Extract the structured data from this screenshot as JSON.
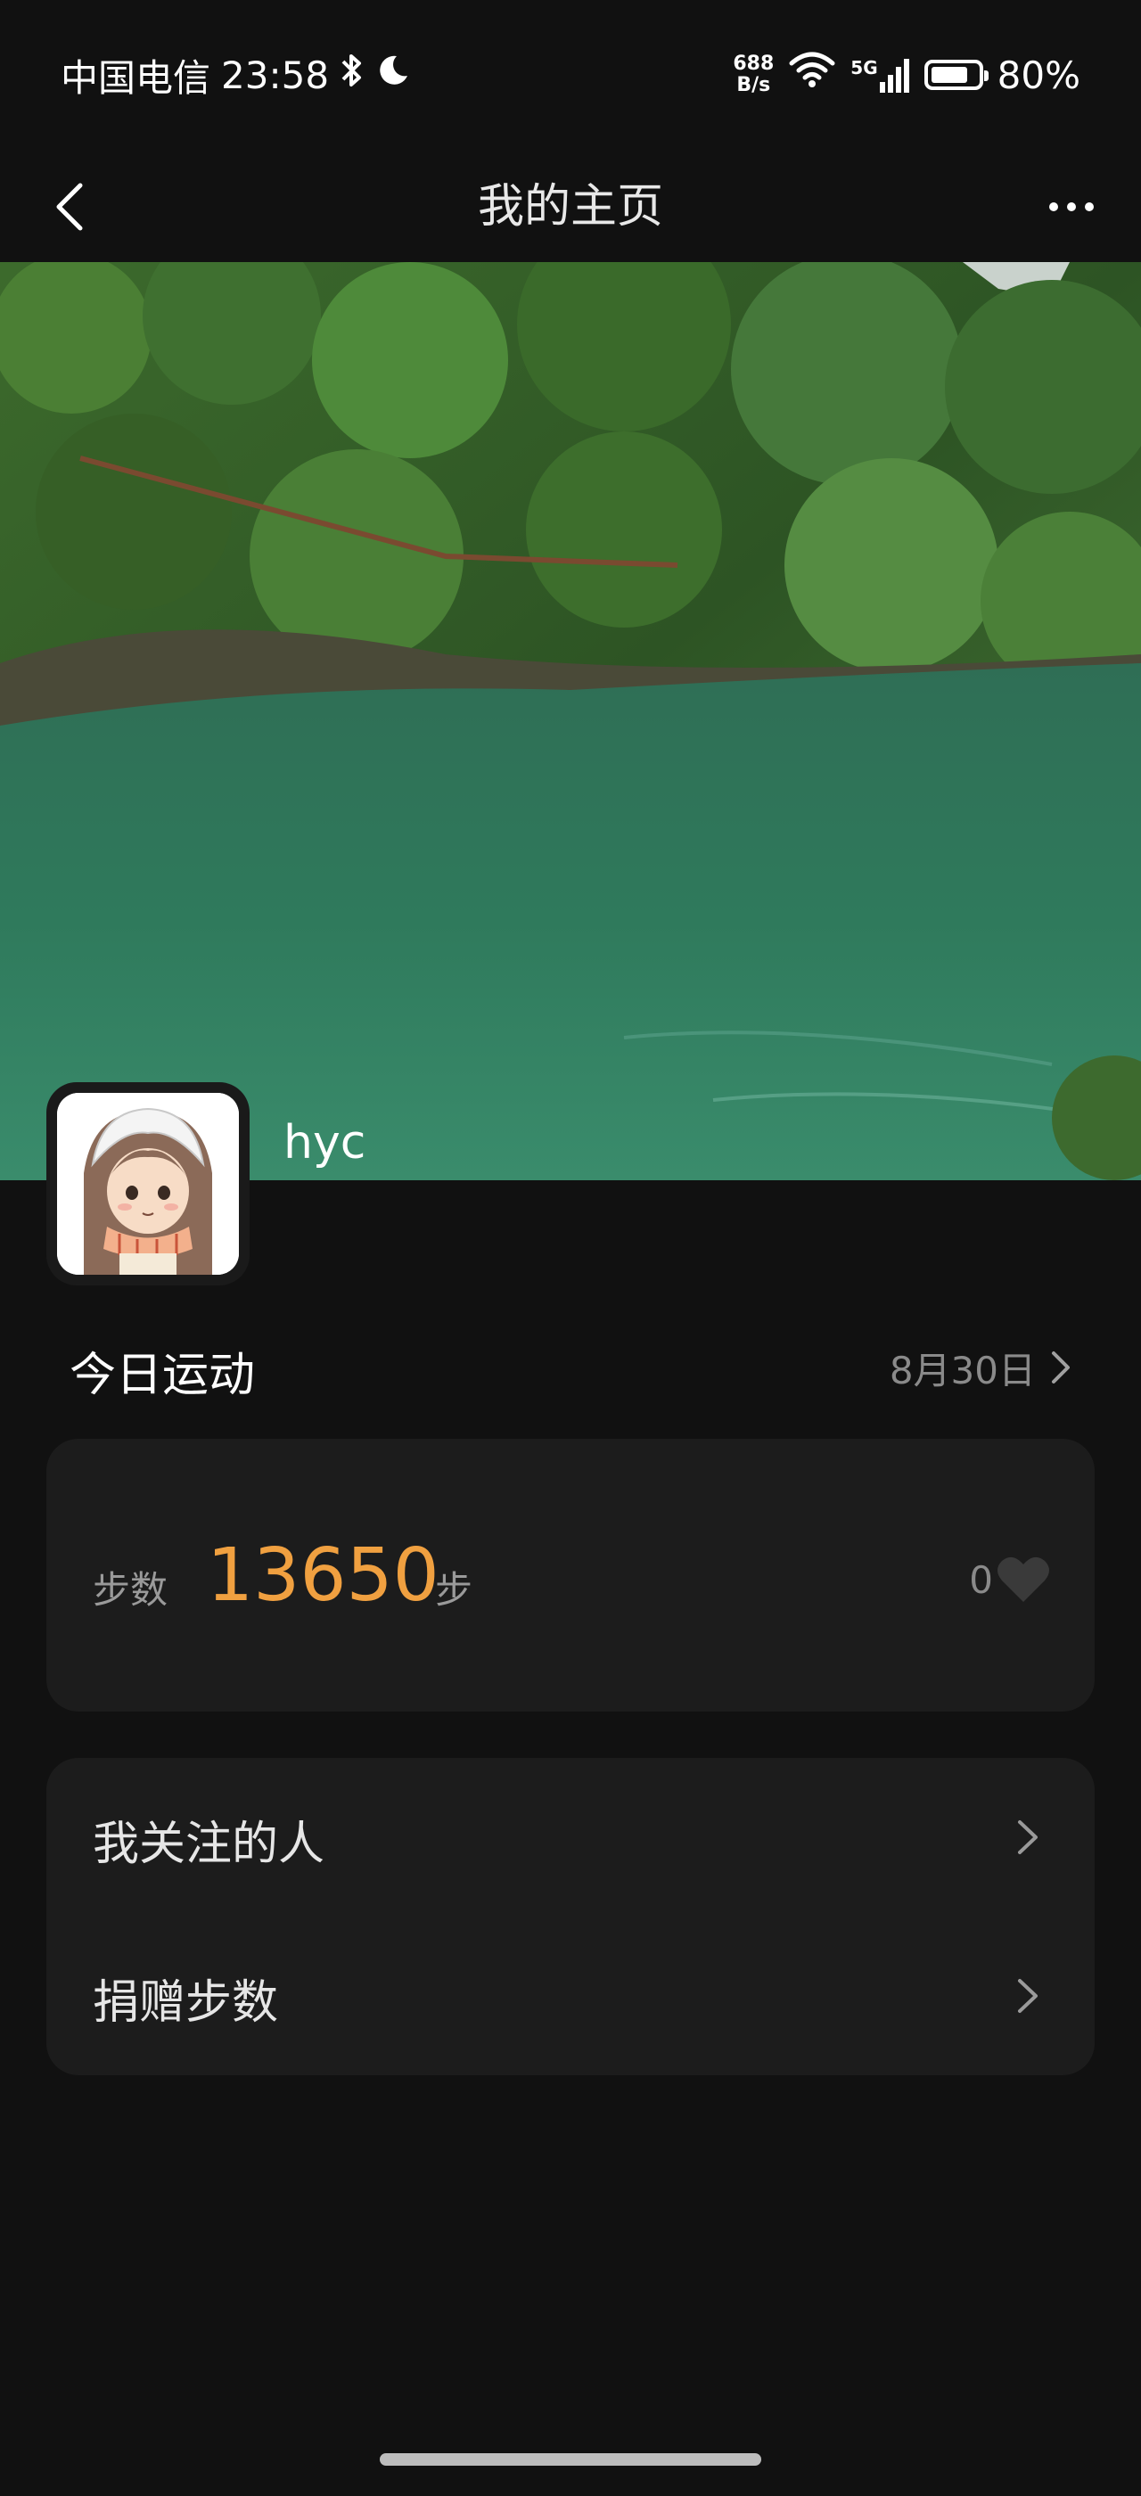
{
  "status_bar": {
    "carrier": "中国电信",
    "time": "23:58",
    "net_speed_value": "688",
    "net_speed_unit": "B/s",
    "network_type": "5G",
    "battery_percent": "80%",
    "battery_level": 0.8
  },
  "nav": {
    "title": "我的主页"
  },
  "profile": {
    "username": "hyc"
  },
  "today": {
    "section_title": "今日运动",
    "date": "8月30日"
  },
  "steps_card": {
    "label": "步数",
    "value": "13650",
    "unit": "步",
    "likes": "0"
  },
  "menu": {
    "items": [
      {
        "label": "我关注的人"
      },
      {
        "label": "捐赠步数"
      }
    ]
  },
  "colors": {
    "background": "#111111",
    "card": "#1c1c1c",
    "accent": "#f0a040"
  },
  "icons": {
    "back": "chevron-left-icon",
    "more": "more-dots-icon",
    "like": "heart-icon",
    "chevron": "chevron-right-icon"
  }
}
